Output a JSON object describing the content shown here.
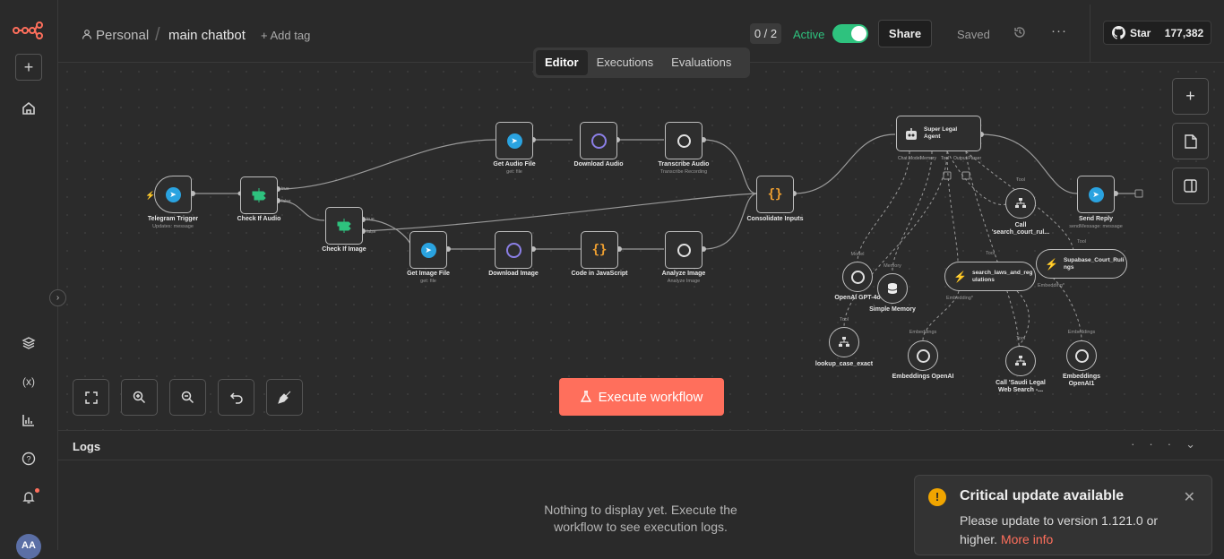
{
  "header": {
    "crumb_owner": "Personal",
    "crumb_sep": "/",
    "workflow_name": "main chatbot",
    "add_tag": "+ Add tag",
    "counter": "0 / 2",
    "active_label": "Active",
    "share": "Share",
    "saved": "Saved",
    "github_star": "Star",
    "github_count": "177,382"
  },
  "tabs": [
    "Editor",
    "Executions",
    "Evaluations"
  ],
  "nodes": {
    "telegram_trigger": {
      "label": "Telegram Trigger",
      "sub": "Updates: message"
    },
    "check_audio": {
      "label": "Check If Audio"
    },
    "check_image": {
      "label": "Check If Image"
    },
    "get_audio": {
      "label": "Get Audio File",
      "sub": "get: file"
    },
    "download_audio": {
      "label": "Download Audio"
    },
    "transcribe_audio": {
      "label": "Transcribe Audio",
      "sub": "Transcribe Recording"
    },
    "get_image": {
      "label": "Get Image File",
      "sub": "get: file"
    },
    "download_image": {
      "label": "Download Image"
    },
    "code_js": {
      "label": "Code in JavaScript"
    },
    "analyze_image": {
      "label": "Analyze Image",
      "sub": "Analyze Image"
    },
    "consolidate": {
      "label": "Consolidate Inputs"
    },
    "agent": {
      "label": "Super Legal Agent",
      "port_chat": "Chat Model",
      "port_memory": "Memory",
      "port_tool": "Tool",
      "port_parser": "Output Parser"
    },
    "send_reply": {
      "label": "Send Reply",
      "sub": "sendMessage: message"
    },
    "call_court": {
      "label": "Call 'search_court_rul...",
      "tag": "Tool"
    },
    "openai_model": {
      "label": "OpenAI GPT-4o",
      "tag": "Model"
    },
    "simple_memory": {
      "label": "Simple Memory",
      "tag": "Memory"
    },
    "search_laws": {
      "label": "search_laws_and_regulations",
      "tag": "Tool",
      "emb": "Embedding*"
    },
    "supabase_court": {
      "label": "Supabase_Court_Rulings",
      "tag": "Tool",
      "emb": "Embedding*"
    },
    "lookup_case": {
      "label": "lookup_case_exact",
      "tag": "Tool"
    },
    "embeddings_openai": {
      "label": "Embeddings OpenAI",
      "tag": "Embeddings"
    },
    "call_saudi": {
      "label": "Call 'Saudi Legal Web Search -...",
      "tag": "Tool"
    },
    "embeddings_openai2": {
      "label": "Embeddings OpenAI1",
      "tag": "Embeddings"
    },
    "true_label": "true",
    "false_label": "false"
  },
  "execute": "Execute workflow",
  "logs": {
    "title": "Logs",
    "empty": "Nothing to display yet. Execute the workflow to see execution logs."
  },
  "toast": {
    "title": "Critical update available",
    "message": "Please update to version 1.121.0 or higher.",
    "link": "More info"
  },
  "avatar": "AA",
  "colors": {
    "accent": "#ff6f5c",
    "active": "#2ec27e",
    "telegram": "#2aa3e0",
    "warning": "#f0a500"
  }
}
